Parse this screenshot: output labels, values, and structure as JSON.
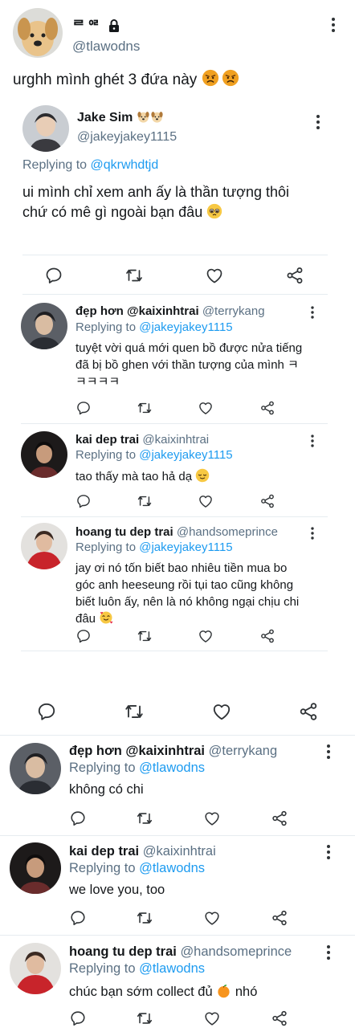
{
  "main_tweet": {
    "display_name": "ᄅᄋᄅ",
    "handle": "@tlawodns",
    "text": "urghh mình ghét 3 đứa này"
  },
  "quoted_tweet": {
    "display_name": "Jake Sim",
    "handle": "@jakeyjakey1115",
    "replying_prefix": "Replying to",
    "replying_to": "@qkrwhdtjd",
    "text_line1": "ui mình chỉ xem anh ấy là thần tượng thôi",
    "text_line2": "chứ có mê gì ngoài bạn đâu"
  },
  "nested_replies": [
    {
      "display_name": "đẹp hơn @kaixinhtrai",
      "handle": "@terrykang",
      "replying_prefix": "Replying to",
      "replying_to": "@jakeyjakey1115",
      "text_line1": "tuyệt vời quá mới quen bồ được nửa tiếng",
      "text_line2": "đã bị bồ ghen với thần tượng của mình ㅋ",
      "text_line3": "ㅋㅋㅋㅋ"
    },
    {
      "display_name": "kai dep trai",
      "handle": "@kaixinhtrai",
      "replying_prefix": "Replying to",
      "replying_to": "@jakeyjakey1115",
      "text_line1": "tao thấy mà tao hả dạ"
    },
    {
      "display_name": "hoang tu dep trai",
      "handle": "@handsomeprince",
      "replying_prefix": "Replying to",
      "replying_to": "@jakeyjakey1115",
      "text_line1": "jay ơi nó tốn biết bao nhiêu tiền mua bo",
      "text_line2": "góc anh heeseung rồi tụi tao cũng không",
      "text_line3": "biết luôn ấy, nên là nó không ngại chịu chi",
      "text_line4": "đâu"
    }
  ],
  "bottom_replies": [
    {
      "display_name": "đẹp hơn @kaixinhtrai",
      "handle": "@terrykang",
      "replying_prefix": "Replying to",
      "replying_to": "@tlawodns",
      "text_line1": "không có chi"
    },
    {
      "display_name": "kai dep trai",
      "handle": "@kaixinhtrai",
      "replying_prefix": "Replying to",
      "replying_to": "@tlawodns",
      "text_line1": "we love you, too"
    },
    {
      "display_name": "hoang tu dep trai",
      "handle": "@handsomeprince",
      "replying_prefix": "Replying to",
      "replying_to": "@tlawodns",
      "text_before": "chúc bạn sớm collect đủ",
      "text_after": "nhó"
    }
  ],
  "colors": {
    "link": "#1d9bf0",
    "secondary": "#5b7083",
    "text": "#14171a"
  },
  "icons": [
    "comment-icon",
    "retweet-icon",
    "like-icon",
    "share-icon",
    "more-icon",
    "lock-icon",
    "angry-face-icon",
    "pleading-face-icon",
    "relieved-face-icon",
    "smiling-hearts-face-icon",
    "tangerine-icon",
    "dog-icon"
  ]
}
